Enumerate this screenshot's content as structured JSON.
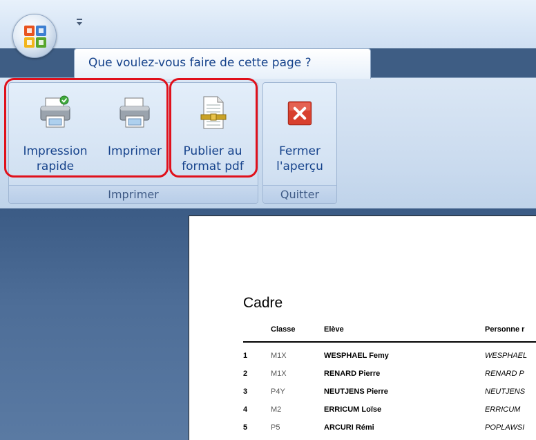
{
  "quick_access": {
    "customize_icon": "dropdown-arrow-icon"
  },
  "office_button": {
    "icon": "office-logo-icon"
  },
  "ribbon": {
    "tab_label": "Que voulez-vous faire de cette page ?",
    "groups": [
      {
        "label": "Imprimer",
        "buttons": [
          {
            "label": "Impression\nrapide",
            "icon": "printer-check-icon"
          },
          {
            "label": "Imprimer",
            "icon": "printer-icon"
          },
          {
            "label": "Publier au\nformat pdf",
            "icon": "pdf-document-icon"
          }
        ]
      },
      {
        "label": "Quitter",
        "buttons": [
          {
            "label": "Fermer\nl'aperçu",
            "icon": "close-red-icon"
          }
        ]
      }
    ]
  },
  "highlight_color": "#e0101b",
  "document": {
    "title": "Cadre",
    "columns": {
      "classe": "Classe",
      "eleve": "Elève",
      "personne": "Personne r"
    },
    "rows": [
      {
        "num": "1",
        "classe": "M1X",
        "eleve": "WESPHAEL Femy",
        "personne": "WESPHAEL"
      },
      {
        "num": "2",
        "classe": "M1X",
        "eleve": "RENARD Pierre",
        "personne": "RENARD P"
      },
      {
        "num": "3",
        "classe": "P4Y",
        "eleve": "NEUTJENS Pierre",
        "personne": "NEUTJENS"
      },
      {
        "num": "4",
        "classe": "M2",
        "eleve": "ERRICUM Loïse",
        "personne": "ERRICUM"
      },
      {
        "num": "5",
        "classe": "P5",
        "eleve": "ARCURI Rémi",
        "personne": "POPLAWSI"
      }
    ]
  }
}
